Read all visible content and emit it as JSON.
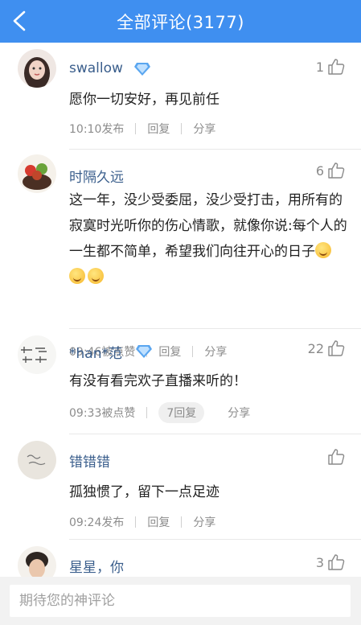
{
  "header": {
    "title": "全部评论(3177)"
  },
  "comments": [
    {
      "username": "swallow",
      "vip": true,
      "likes": "1",
      "text": "愿你一切安好，再见前任",
      "time": "10:10发布",
      "reply": "回复",
      "share": "分享"
    },
    {
      "username": "时隔久远",
      "vip": false,
      "likes": "6",
      "text": "这一年，没少受委屈，没少受打击，用所有的寂寞时光听你的伤心情歌，就像你说:每个人的一生都不简单，希望我们向往开心的日子",
      "time": "09:46被点赞",
      "reply": "回复",
      "share": "分享"
    },
    {
      "username": "*han*范",
      "vip": true,
      "likes": "22",
      "text": "有没有看完欢子直播来听的！",
      "time": "09:33被点赞",
      "reply": "7回复",
      "share": "分享"
    },
    {
      "username": "错错错",
      "vip": false,
      "likes": "",
      "text": "孤独惯了，留下一点足迹",
      "time": "09:24发布",
      "reply": "回复",
      "share": "分享"
    },
    {
      "username": "星星，你",
      "vip": false,
      "likes": "3"
    }
  ],
  "footer": {
    "placeholder": "期待您的神评论"
  },
  "colors": {
    "header": "#3f8ff0",
    "username": "#3a5e8c",
    "vip": "#5aa6f0"
  },
  "icons": {
    "back": "back-arrow-icon",
    "like": "thumbs-up-icon",
    "vip": "diamond-icon"
  }
}
